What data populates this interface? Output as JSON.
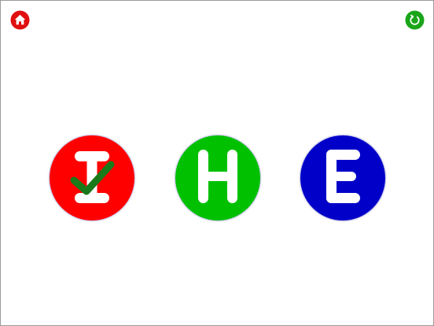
{
  "toolbar": {
    "home_icon": "home-icon",
    "refresh_icon": "refresh-icon",
    "home_color": "#e01010",
    "refresh_color": "#1aa51a"
  },
  "letters": [
    {
      "letter": "I",
      "color": "#ff0000",
      "selected": true,
      "check_color": "#1a7a1a"
    },
    {
      "letter": "H",
      "color": "#00c000",
      "selected": false
    },
    {
      "letter": "E",
      "color": "#0000c8",
      "selected": false
    }
  ]
}
